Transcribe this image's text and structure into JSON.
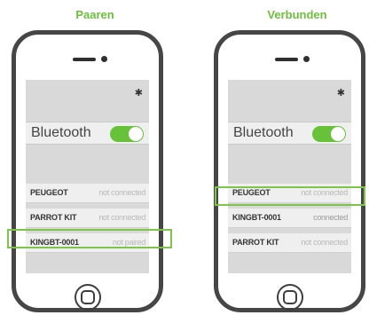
{
  "panels": [
    {
      "title": "Paaren",
      "status_icon": "bluetooth-icon",
      "bluetooth_label": "Bluetooth",
      "bluetooth_toggle_on": true,
      "devices": [
        {
          "name": "PEUGEOT",
          "status": "not connected",
          "highlighted": false
        },
        {
          "name": "PARROT KIT",
          "status": "not connected",
          "highlighted": false
        },
        {
          "name": "KINGBT-0001",
          "status": "not paired",
          "highlighted": true
        }
      ]
    },
    {
      "title": "Verbunden",
      "status_icon": "bluetooth-icon",
      "bluetooth_label": "Bluetooth",
      "bluetooth_toggle_on": true,
      "devices": [
        {
          "name": "PEUGEOT",
          "status": "not connected",
          "highlighted": false
        },
        {
          "name": "KINGBT-0001",
          "status": "connected",
          "highlighted": true
        },
        {
          "name": "PARROT KIT",
          "status": "not connected",
          "highlighted": false
        }
      ]
    }
  ],
  "colors": {
    "accent_green": "#6cbf3b",
    "toggle_green": "#67c23a",
    "phone_frame": "#464646",
    "screen_bg": "#d9d9d9"
  }
}
